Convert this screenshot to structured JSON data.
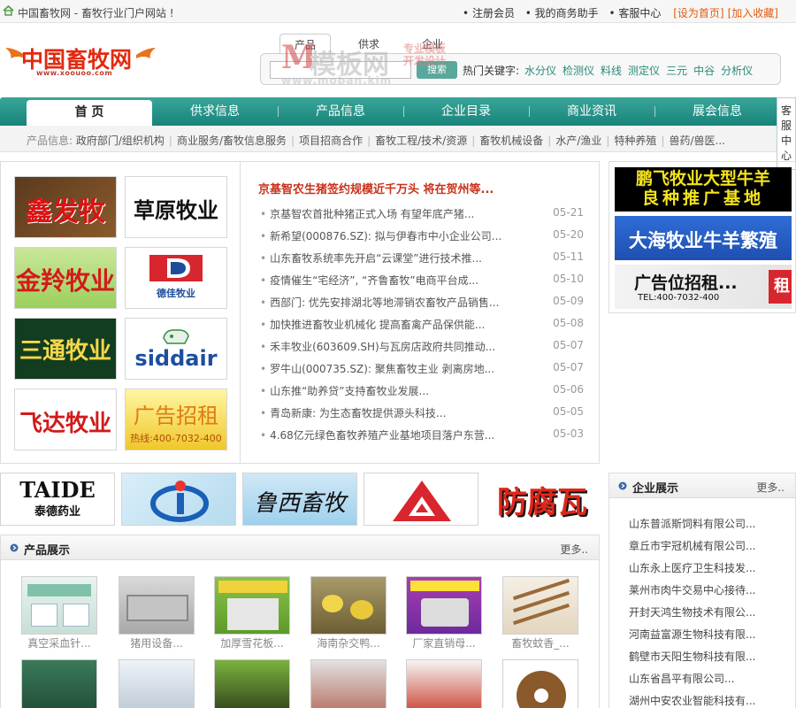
{
  "topbar": {
    "site_name": "中国畜牧网 - 畜牧行业门户网站 !",
    "links": [
      "• 注册会员",
      "• 我的商务助手",
      "• 客服中心"
    ],
    "set_home": "[设为首页]",
    "add_fav": "[加入收藏]"
  },
  "logo": {
    "text": "中国畜牧网",
    "url": "www.xoouoo.com"
  },
  "watermark": {
    "m": "M",
    "big": "模板网",
    "side1": "专业模板",
    "side2": "开发设计",
    "url": "www.moban.kim"
  },
  "search": {
    "tabs": [
      "产品",
      "供求",
      "企业"
    ],
    "button": "搜索",
    "hot_label": "热门关键字:",
    "hot_keywords": [
      "水分仪",
      "检测仪",
      "料线",
      "测定仪",
      "三元",
      "中谷",
      "分析仪"
    ]
  },
  "nav": {
    "items": [
      "首 页",
      "供求信息",
      "产品信息",
      "企业目录",
      "商业资讯",
      "展会信息"
    ]
  },
  "service": {
    "chars": [
      "客",
      "服",
      "中",
      "心"
    ]
  },
  "subnav": {
    "label": "产品信息:",
    "items": [
      "政府部门/组织机构",
      "商业服务/畜牧信息服务",
      "项目招商合作",
      "畜牧工程/技术/资源",
      "畜牧机械设备",
      "水产/渔业",
      "特种养殖",
      "兽药/兽医..."
    ]
  },
  "brands": [
    {
      "name": "鑫发牧业"
    },
    {
      "name": "草原牧业"
    },
    {
      "name": "金羚牧业"
    },
    {
      "name": "德佳牧业"
    },
    {
      "name": "三通牧业"
    },
    {
      "name": "siddair"
    },
    {
      "name": "飞达牧业"
    },
    {
      "name": "广告招租",
      "sub": "热线:400-7032-400"
    }
  ],
  "news": {
    "headline": "京基智农生猪签约规模近千万头 将在贺州等...",
    "items": [
      {
        "title": "京基智农首批种猪正式入场 有望年底产猪...",
        "date": "05-21"
      },
      {
        "title": "新希望(000876.SZ): 拟与伊春市中小企业公司...",
        "date": "05-20"
      },
      {
        "title": "山东畜牧系统率先开启“云课堂”进行技术推...",
        "date": "05-11"
      },
      {
        "title": "疫情催生“宅经济”, “齐鲁畜牧”电商平台成...",
        "date": "05-10"
      },
      {
        "title": "西部门: 优先安排湖北等地滞销农畜牧产品销售...",
        "date": "05-09"
      },
      {
        "title": "加快推进畜牧业机械化 提高畜禽产品保供能...",
        "date": "05-08"
      },
      {
        "title": "禾丰牧业(603609.SH)与瓦房店政府共同推动...",
        "date": "05-07"
      },
      {
        "title": "罗牛山(000735.SZ): 聚焦畜牧主业 剥离房地...",
        "date": "05-07"
      },
      {
        "title": "山东推“助养贷”支持畜牧业发展...",
        "date": "05-06"
      },
      {
        "title": "青岛新康: 为生态畜牧提供源头科技...",
        "date": "05-05"
      },
      {
        "title": "4.68亿元绿色畜牧养殖产业基地项目落户东营...",
        "date": "05-03"
      }
    ]
  },
  "right_banners": {
    "b1_line1": "鹏飞牧业大型牛羊",
    "b1_line2": "良种推广基地",
    "b2": "大海牧业牛羊繁殖",
    "b3": "广告位招租...",
    "b3_tel": "TEL:400-7032-400",
    "b3_side": "租"
  },
  "ads": {
    "taide_en": "TAIDE",
    "taide_cn": "泰德药业",
    "luxi": "鲁西畜牧",
    "fangfu": "防腐瓦"
  },
  "products": {
    "title": "产品展示",
    "more": "更多..",
    "row1_captions": [
      "真空采血针...",
      "猪用设备...",
      "加厚雪花板...",
      "海南杂交鸭...",
      "厂家直销母...",
      "畜牧蚊香_..."
    ],
    "row2_captions": []
  },
  "companies": {
    "title": "企业展示",
    "more": "更多..",
    "items": [
      "山东普派斯饲料有限公司...",
      "章丘市宇冠机械有限公司...",
      "山东永上医疗卫生科技发...",
      "莱州市肉牛交易中心接待...",
      "开封天鸿生物技术有限公...",
      "河南益富源生物科技有限...",
      "鹤壁市天阳生物科技有限...",
      "山东省昌平有限公司...",
      "湖州中安农业智能科技有..."
    ]
  },
  "colors": {
    "brand_teal": "#18837a",
    "accent_red": "#c8321b",
    "link_green": "#2a8a7a",
    "orange": "#e25c0b"
  }
}
